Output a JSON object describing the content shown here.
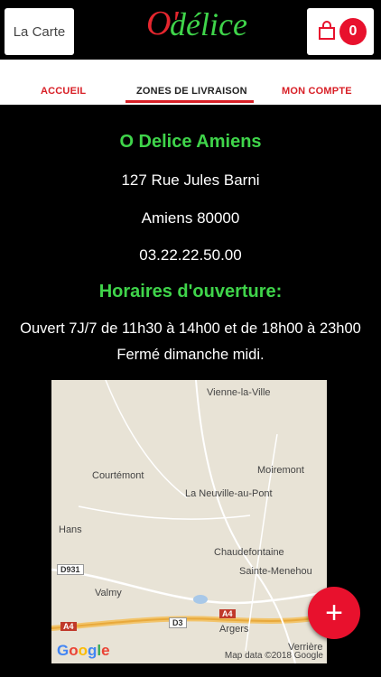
{
  "header": {
    "menu_label": "La Carte",
    "logo_first": "O'",
    "logo_rest": "délice",
    "cart_count": "0"
  },
  "nav": {
    "tabs": [
      {
        "label": "ACCUEIL"
      },
      {
        "label": "ZONES DE LIVRAISON"
      },
      {
        "label": "MON COMPTE"
      }
    ]
  },
  "store": {
    "name": "O Delice Amiens",
    "address": "127 Rue Jules Barni",
    "city": "Amiens 80000",
    "phone": "03.22.22.50.00"
  },
  "hours": {
    "title": "Horaires d'ouverture:",
    "line1": "Ouvert 7J/7 de 11h30 à 14h00 et de 18h00 à 23h00",
    "line2": "Fermé dimanche midi."
  },
  "map": {
    "places": [
      "Vienne-la-Ville",
      "Courtémont",
      "Moiremont",
      "La Neuville-au-Pont",
      "Hans",
      "Chaudefontaine",
      "Sainte-Menehou",
      "Valmy",
      "Argers",
      "Verrière"
    ],
    "roads": [
      "D931",
      "A4",
      "D3",
      "A4"
    ],
    "brand": "Google",
    "credit": "Map data ©2018 Google"
  },
  "fab": {
    "icon": "plus-icon",
    "symbol": "+"
  },
  "colors": {
    "accent_red": "#e8112d",
    "accent_green": "#3fd44a",
    "background": "#000000"
  }
}
